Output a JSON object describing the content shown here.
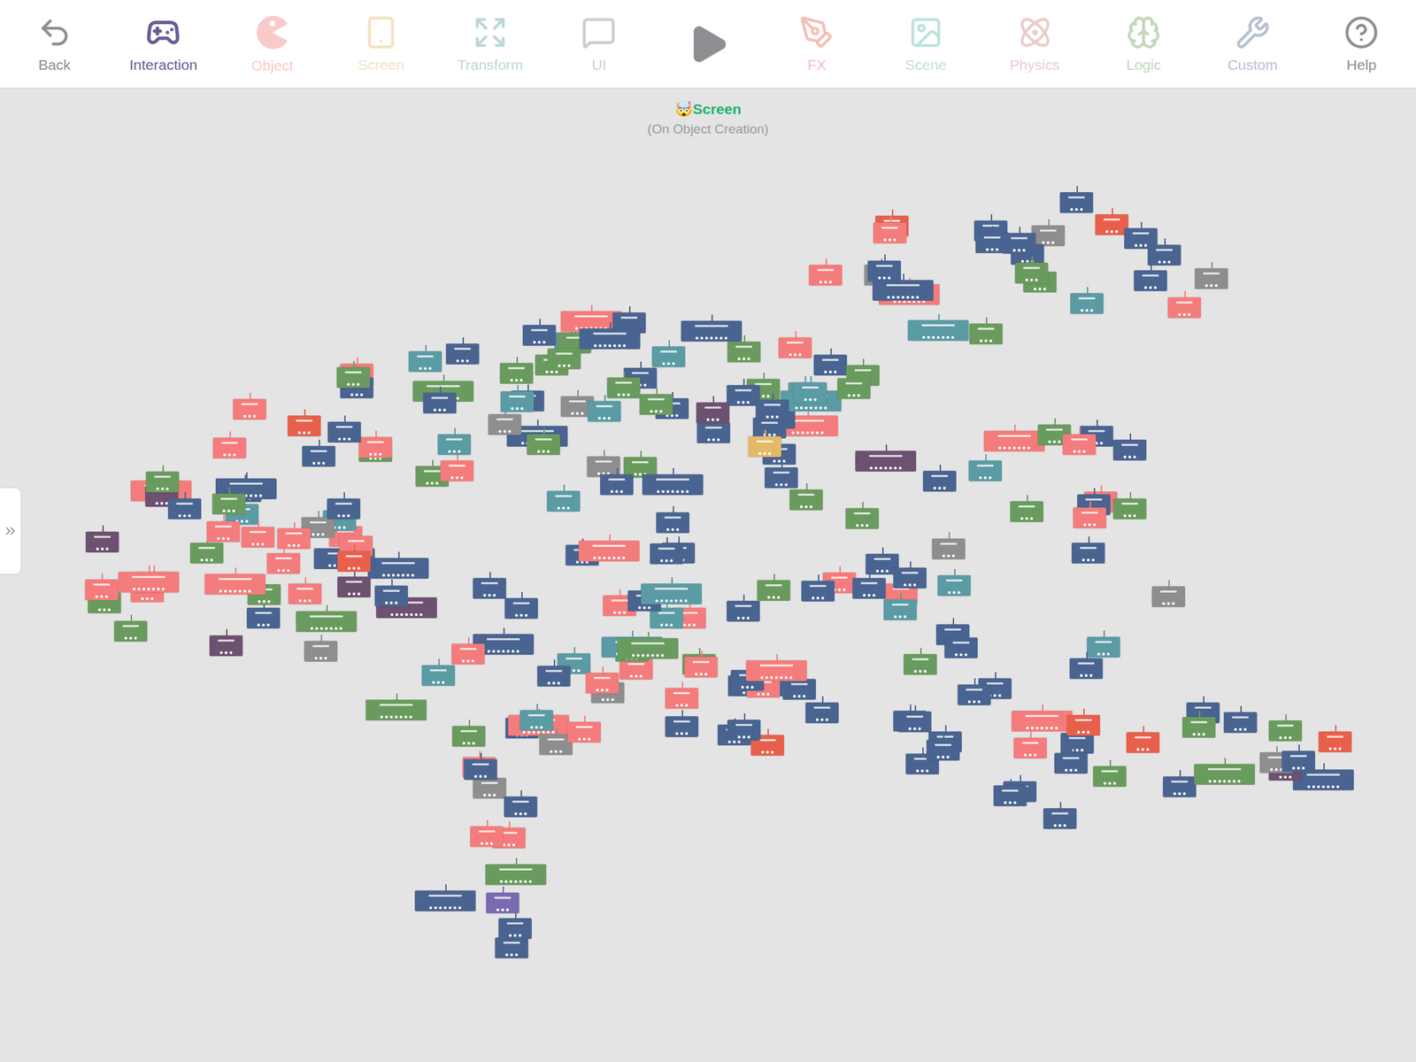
{
  "toolbar": {
    "items": [
      {
        "label": "Back",
        "disabled": false,
        "selected": false,
        "color": "#8e8e93"
      },
      {
        "label": "Interaction",
        "disabled": false,
        "selected": true,
        "color": "#6b5b95"
      },
      {
        "label": "Object",
        "disabled": true,
        "selected": false,
        "color": "#f47c7c"
      },
      {
        "label": "Screen",
        "disabled": true,
        "selected": false,
        "color": "#e4b96a"
      },
      {
        "label": "Transform",
        "disabled": true,
        "selected": false,
        "color": "#5b9ba3"
      },
      {
        "label": "UI",
        "disabled": true,
        "selected": false,
        "color": "#8a7f86"
      },
      {
        "label": "",
        "disabled": false,
        "selected": false,
        "color": "#8e8e93"
      },
      {
        "label": "FX",
        "disabled": true,
        "selected": false,
        "color": "#e8604c"
      },
      {
        "label": "Scene",
        "disabled": true,
        "selected": false,
        "color": "#5bb8a8"
      },
      {
        "label": "Physics",
        "disabled": true,
        "selected": false,
        "color": "#c9867f"
      },
      {
        "label": "Logic",
        "disabled": true,
        "selected": false,
        "color": "#6a9b5e"
      },
      {
        "label": "Custom",
        "disabled": true,
        "selected": false,
        "color": "#4a6491"
      },
      {
        "label": "Help",
        "disabled": false,
        "selected": false,
        "color": "#8e8e93"
      }
    ]
  },
  "header": {
    "title": "🤯Screen",
    "subtitle": "(On Object Creation)"
  },
  "nodes": [
    {
      "color": "#4a6491"
    },
    {
      "color": "#f47c7c"
    },
    {
      "color": "#6a9b5e"
    },
    {
      "color": "#4a6491"
    },
    {
      "color": "#5b9ba3"
    },
    {
      "color": "#4a6491"
    },
    {
      "color": "#8e8e8e"
    },
    {
      "color": "#f47c7c"
    },
    {
      "color": "#4a6491"
    },
    {
      "color": "#6a9b5e"
    },
    {
      "color": "#4a6491"
    },
    {
      "color": "#6a9b5e"
    },
    {
      "color": "#f47c7c"
    },
    {
      "color": "#4a6491"
    },
    {
      "color": "#6d5170"
    },
    {
      "color": "#4a6491"
    },
    {
      "color": "#5b9ba3"
    },
    {
      "color": "#f47c7c"
    },
    {
      "color": "#6a9b5e"
    },
    {
      "color": "#e8604c"
    },
    {
      "color": "#4a6491"
    },
    {
      "color": "#f47c7c"
    },
    {
      "color": "#4a6491"
    },
    {
      "color": "#6a9b5e"
    },
    {
      "color": "#5b9ba3"
    },
    {
      "color": "#8e8e8e"
    },
    {
      "color": "#4a6491"
    },
    {
      "color": "#f47c7c"
    },
    {
      "color": "#4a6491"
    },
    {
      "color": "#6a9b5e"
    },
    {
      "color": "#f47c7c"
    },
    {
      "color": "#4a6491"
    },
    {
      "color": "#6a9b5e"
    },
    {
      "color": "#4a6491"
    },
    {
      "color": "#5b9ba3"
    },
    {
      "color": "#4a6491"
    },
    {
      "color": "#e8604c"
    },
    {
      "color": "#f47c7c"
    },
    {
      "color": "#6d5170"
    },
    {
      "color": "#4a6491"
    },
    {
      "color": "#6a9b5e"
    },
    {
      "color": "#4a6491"
    },
    {
      "color": "#f47c7c"
    },
    {
      "color": "#4a6491"
    },
    {
      "color": "#8e8e8e"
    },
    {
      "color": "#4a6491"
    },
    {
      "color": "#6a9b5e"
    },
    {
      "color": "#5b9ba3"
    },
    {
      "color": "#4a6491"
    },
    {
      "color": "#f47c7c"
    },
    {
      "color": "#4a6491"
    },
    {
      "color": "#5b9ba3"
    },
    {
      "color": "#f47c7c"
    },
    {
      "color": "#6a9b5e"
    },
    {
      "color": "#4a6491"
    },
    {
      "color": "#4a6491"
    },
    {
      "color": "#f47c7c"
    },
    {
      "color": "#8e8e8e"
    },
    {
      "color": "#6a9b5e"
    },
    {
      "color": "#4a6491"
    },
    {
      "color": "#e8604c"
    },
    {
      "color": "#4a6491"
    },
    {
      "color": "#f47c7c"
    },
    {
      "color": "#6a9b5e"
    },
    {
      "color": "#4a6491"
    },
    {
      "color": "#5b9ba3"
    },
    {
      "color": "#4a6491"
    },
    {
      "color": "#6d5170"
    },
    {
      "color": "#f47c7c"
    },
    {
      "color": "#4a6491"
    },
    {
      "color": "#4a6491"
    },
    {
      "color": "#6a9b5e"
    },
    {
      "color": "#4a6491"
    },
    {
      "color": "#f47c7c"
    },
    {
      "color": "#5b9ba3"
    },
    {
      "color": "#4a6491"
    },
    {
      "color": "#8e8e8e"
    },
    {
      "color": "#6a9b5e"
    },
    {
      "color": "#4a6491"
    },
    {
      "color": "#f47c7c"
    },
    {
      "color": "#f47c7c"
    },
    {
      "color": "#4a6491"
    },
    {
      "color": "#6a9b5e"
    },
    {
      "color": "#5b9ba3"
    },
    {
      "color": "#4a6491"
    },
    {
      "color": "#4a6491"
    },
    {
      "color": "#f47c7c"
    },
    {
      "color": "#6a9b5e"
    },
    {
      "color": "#7a6bb0"
    },
    {
      "color": "#4a6491"
    },
    {
      "color": "#4a6491"
    },
    {
      "color": "#f47c7c"
    },
    {
      "color": "#8e8e8e"
    },
    {
      "color": "#4a6491"
    },
    {
      "color": "#6a9b5e"
    },
    {
      "color": "#5b9ba3"
    },
    {
      "color": "#4a6491"
    },
    {
      "color": "#f47c7c"
    },
    {
      "color": "#4a6491"
    },
    {
      "color": "#e8604c"
    },
    {
      "color": "#6a9b5e"
    },
    {
      "color": "#4a6491"
    },
    {
      "color": "#f47c7c"
    },
    {
      "color": "#4a6491"
    },
    {
      "color": "#5b9ba3"
    },
    {
      "color": "#6d5170"
    },
    {
      "color": "#4a6491"
    },
    {
      "color": "#6a9b5e"
    },
    {
      "color": "#f47c7c"
    },
    {
      "color": "#4a6491"
    },
    {
      "color": "#4a6491"
    },
    {
      "color": "#8e8e8e"
    },
    {
      "color": "#f47c7c"
    },
    {
      "color": "#6a9b5e"
    },
    {
      "color": "#4a6491"
    },
    {
      "color": "#5b9ba3"
    },
    {
      "color": "#f47c7c"
    },
    {
      "color": "#4a6491"
    },
    {
      "color": "#6a9b5e"
    },
    {
      "color": "#4a6491"
    },
    {
      "color": "#f47c7c"
    },
    {
      "color": "#4a6491"
    },
    {
      "color": "#6a9b5e"
    },
    {
      "color": "#4a6491"
    },
    {
      "color": "#e8604c"
    },
    {
      "color": "#4a6491"
    },
    {
      "color": "#5b9ba3"
    },
    {
      "color": "#f47c7c"
    },
    {
      "color": "#8e8e8e"
    },
    {
      "color": "#4a6491"
    },
    {
      "color": "#4a6491"
    },
    {
      "color": "#6a9b5e"
    },
    {
      "color": "#f47c7c"
    },
    {
      "color": "#4a6491"
    },
    {
      "color": "#5b9ba3"
    },
    {
      "color": "#4a6491"
    },
    {
      "color": "#6a9b5e"
    },
    {
      "color": "#6d5170"
    },
    {
      "color": "#f47c7c"
    },
    {
      "color": "#4a6491"
    },
    {
      "color": "#5b9ba3"
    },
    {
      "color": "#4a6491"
    },
    {
      "color": "#f47c7c"
    },
    {
      "color": "#6a9b5e"
    },
    {
      "color": "#4a6491"
    },
    {
      "color": "#8e8e8e"
    },
    {
      "color": "#4a6491"
    },
    {
      "color": "#f47c7c"
    },
    {
      "color": "#6a9b5e"
    },
    {
      "color": "#4a6491"
    },
    {
      "color": "#4a6491"
    },
    {
      "color": "#f47c7c"
    },
    {
      "color": "#4a6491"
    },
    {
      "color": "#6a9b5e"
    },
    {
      "color": "#5b9ba3"
    },
    {
      "color": "#4a6491"
    },
    {
      "color": "#e8604c"
    },
    {
      "color": "#f47c7c"
    },
    {
      "color": "#4a6491"
    },
    {
      "color": "#6a9b5e"
    },
    {
      "color": "#6a9b5e"
    },
    {
      "color": "#4a6491"
    },
    {
      "color": "#f47c7c"
    },
    {
      "color": "#8e8e8e"
    },
    {
      "color": "#4a6491"
    },
    {
      "color": "#5b9ba3"
    },
    {
      "color": "#4a6491"
    },
    {
      "color": "#f47c7c"
    },
    {
      "color": "#6a9b5e"
    },
    {
      "color": "#6d5170"
    },
    {
      "color": "#4a6491"
    },
    {
      "color": "#5b9ba3"
    },
    {
      "color": "#6a9b5e"
    },
    {
      "color": "#f47c7c"
    },
    {
      "color": "#4a6491"
    },
    {
      "color": "#4a6491"
    },
    {
      "color": "#8e8e8e"
    },
    {
      "color": "#f47c7c"
    },
    {
      "color": "#6a9b5e"
    },
    {
      "color": "#4a6491"
    },
    {
      "color": "#f47c7c"
    },
    {
      "color": "#4a6491"
    },
    {
      "color": "#6a9b5e"
    },
    {
      "color": "#4a6491"
    },
    {
      "color": "#5b9ba3"
    },
    {
      "color": "#4a6491"
    },
    {
      "color": "#f47c7c"
    },
    {
      "color": "#e8604c"
    },
    {
      "color": "#4a6491"
    },
    {
      "color": "#6a9b5e"
    },
    {
      "color": "#4a6491"
    },
    {
      "color": "#6a9b5e"
    },
    {
      "color": "#f47c7c"
    },
    {
      "color": "#4a6491"
    },
    {
      "color": "#8e8e8e"
    },
    {
      "color": "#5b9ba3"
    },
    {
      "color": "#4a6491"
    },
    {
      "color": "#f47c7c"
    },
    {
      "color": "#6a9b5e"
    },
    {
      "color": "#4a6491"
    },
    {
      "color": "#e4b96a"
    },
    {
      "color": "#4a6491"
    },
    {
      "color": "#f47c7c"
    },
    {
      "color": "#6a9b5e"
    },
    {
      "color": "#4a6491"
    },
    {
      "color": "#5b9ba3"
    },
    {
      "color": "#4a6491"
    },
    {
      "color": "#6d5170"
    },
    {
      "color": "#f47c7c"
    },
    {
      "color": "#4a6491"
    },
    {
      "color": "#4a6491"
    },
    {
      "color": "#f47c7c"
    },
    {
      "color": "#6a9b5e"
    },
    {
      "color": "#4a6491"
    },
    {
      "color": "#5b9ba3"
    },
    {
      "color": "#8e8e8e"
    },
    {
      "color": "#4a6491"
    },
    {
      "color": "#f47c7c"
    },
    {
      "color": "#6a9b5e"
    },
    {
      "color": "#e8604c"
    },
    {
      "color": "#6a9b5e"
    },
    {
      "color": "#4a6491"
    },
    {
      "color": "#f47c7c"
    },
    {
      "color": "#4a6491"
    },
    {
      "color": "#5b9ba3"
    },
    {
      "color": "#4a6491"
    },
    {
      "color": "#6a9b5e"
    },
    {
      "color": "#f47c7c"
    },
    {
      "color": "#4a6491"
    },
    {
      "color": "#8e8e8e"
    },
    {
      "color": "#4a6491"
    },
    {
      "color": "#f47c7c"
    },
    {
      "color": "#6a9b5e"
    },
    {
      "color": "#5b9ba3"
    },
    {
      "color": "#4a6491"
    },
    {
      "color": "#6d5170"
    },
    {
      "color": "#4a6491"
    },
    {
      "color": "#6a9b5e"
    },
    {
      "color": "#f47c7c"
    },
    {
      "color": "#4a6491"
    }
  ]
}
